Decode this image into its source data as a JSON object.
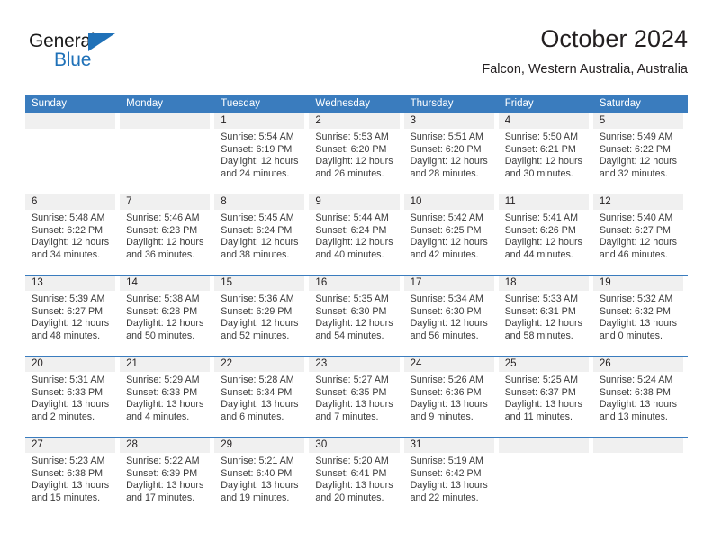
{
  "brand": {
    "name_top": "General",
    "name_bottom": "Blue",
    "triangle_icon": "blue-triangle-icon",
    "accent_color": "#1f71b8"
  },
  "header": {
    "title": "October 2024",
    "location": "Falcon, Western Australia, Australia"
  },
  "calendar": {
    "header_color": "#3a7cbe",
    "daynum_band_color": "#f0f0f0",
    "weekdays": [
      "Sunday",
      "Monday",
      "Tuesday",
      "Wednesday",
      "Thursday",
      "Friday",
      "Saturday"
    ],
    "weeks": [
      [
        {
          "day": "",
          "empty": true
        },
        {
          "day": "",
          "empty": true
        },
        {
          "day": "1",
          "sunrise": "Sunrise: 5:54 AM",
          "sunset": "Sunset: 6:19 PM",
          "daylight": "Daylight: 12 hours and 24 minutes."
        },
        {
          "day": "2",
          "sunrise": "Sunrise: 5:53 AM",
          "sunset": "Sunset: 6:20 PM",
          "daylight": "Daylight: 12 hours and 26 minutes."
        },
        {
          "day": "3",
          "sunrise": "Sunrise: 5:51 AM",
          "sunset": "Sunset: 6:20 PM",
          "daylight": "Daylight: 12 hours and 28 minutes."
        },
        {
          "day": "4",
          "sunrise": "Sunrise: 5:50 AM",
          "sunset": "Sunset: 6:21 PM",
          "daylight": "Daylight: 12 hours and 30 minutes."
        },
        {
          "day": "5",
          "sunrise": "Sunrise: 5:49 AM",
          "sunset": "Sunset: 6:22 PM",
          "daylight": "Daylight: 12 hours and 32 minutes."
        }
      ],
      [
        {
          "day": "6",
          "sunrise": "Sunrise: 5:48 AM",
          "sunset": "Sunset: 6:22 PM",
          "daylight": "Daylight: 12 hours and 34 minutes."
        },
        {
          "day": "7",
          "sunrise": "Sunrise: 5:46 AM",
          "sunset": "Sunset: 6:23 PM",
          "daylight": "Daylight: 12 hours and 36 minutes."
        },
        {
          "day": "8",
          "sunrise": "Sunrise: 5:45 AM",
          "sunset": "Sunset: 6:24 PM",
          "daylight": "Daylight: 12 hours and 38 minutes."
        },
        {
          "day": "9",
          "sunrise": "Sunrise: 5:44 AM",
          "sunset": "Sunset: 6:24 PM",
          "daylight": "Daylight: 12 hours and 40 minutes."
        },
        {
          "day": "10",
          "sunrise": "Sunrise: 5:42 AM",
          "sunset": "Sunset: 6:25 PM",
          "daylight": "Daylight: 12 hours and 42 minutes."
        },
        {
          "day": "11",
          "sunrise": "Sunrise: 5:41 AM",
          "sunset": "Sunset: 6:26 PM",
          "daylight": "Daylight: 12 hours and 44 minutes."
        },
        {
          "day": "12",
          "sunrise": "Sunrise: 5:40 AM",
          "sunset": "Sunset: 6:27 PM",
          "daylight": "Daylight: 12 hours and 46 minutes."
        }
      ],
      [
        {
          "day": "13",
          "sunrise": "Sunrise: 5:39 AM",
          "sunset": "Sunset: 6:27 PM",
          "daylight": "Daylight: 12 hours and 48 minutes."
        },
        {
          "day": "14",
          "sunrise": "Sunrise: 5:38 AM",
          "sunset": "Sunset: 6:28 PM",
          "daylight": "Daylight: 12 hours and 50 minutes."
        },
        {
          "day": "15",
          "sunrise": "Sunrise: 5:36 AM",
          "sunset": "Sunset: 6:29 PM",
          "daylight": "Daylight: 12 hours and 52 minutes."
        },
        {
          "day": "16",
          "sunrise": "Sunrise: 5:35 AM",
          "sunset": "Sunset: 6:30 PM",
          "daylight": "Daylight: 12 hours and 54 minutes."
        },
        {
          "day": "17",
          "sunrise": "Sunrise: 5:34 AM",
          "sunset": "Sunset: 6:30 PM",
          "daylight": "Daylight: 12 hours and 56 minutes."
        },
        {
          "day": "18",
          "sunrise": "Sunrise: 5:33 AM",
          "sunset": "Sunset: 6:31 PM",
          "daylight": "Daylight: 12 hours and 58 minutes."
        },
        {
          "day": "19",
          "sunrise": "Sunrise: 5:32 AM",
          "sunset": "Sunset: 6:32 PM",
          "daylight": "Daylight: 13 hours and 0 minutes."
        }
      ],
      [
        {
          "day": "20",
          "sunrise": "Sunrise: 5:31 AM",
          "sunset": "Sunset: 6:33 PM",
          "daylight": "Daylight: 13 hours and 2 minutes."
        },
        {
          "day": "21",
          "sunrise": "Sunrise: 5:29 AM",
          "sunset": "Sunset: 6:33 PM",
          "daylight": "Daylight: 13 hours and 4 minutes."
        },
        {
          "day": "22",
          "sunrise": "Sunrise: 5:28 AM",
          "sunset": "Sunset: 6:34 PM",
          "daylight": "Daylight: 13 hours and 6 minutes."
        },
        {
          "day": "23",
          "sunrise": "Sunrise: 5:27 AM",
          "sunset": "Sunset: 6:35 PM",
          "daylight": "Daylight: 13 hours and 7 minutes."
        },
        {
          "day": "24",
          "sunrise": "Sunrise: 5:26 AM",
          "sunset": "Sunset: 6:36 PM",
          "daylight": "Daylight: 13 hours and 9 minutes."
        },
        {
          "day": "25",
          "sunrise": "Sunrise: 5:25 AM",
          "sunset": "Sunset: 6:37 PM",
          "daylight": "Daylight: 13 hours and 11 minutes."
        },
        {
          "day": "26",
          "sunrise": "Sunrise: 5:24 AM",
          "sunset": "Sunset: 6:38 PM",
          "daylight": "Daylight: 13 hours and 13 minutes."
        }
      ],
      [
        {
          "day": "27",
          "sunrise": "Sunrise: 5:23 AM",
          "sunset": "Sunset: 6:38 PM",
          "daylight": "Daylight: 13 hours and 15 minutes."
        },
        {
          "day": "28",
          "sunrise": "Sunrise: 5:22 AM",
          "sunset": "Sunset: 6:39 PM",
          "daylight": "Daylight: 13 hours and 17 minutes."
        },
        {
          "day": "29",
          "sunrise": "Sunrise: 5:21 AM",
          "sunset": "Sunset: 6:40 PM",
          "daylight": "Daylight: 13 hours and 19 minutes."
        },
        {
          "day": "30",
          "sunrise": "Sunrise: 5:20 AM",
          "sunset": "Sunset: 6:41 PM",
          "daylight": "Daylight: 13 hours and 20 minutes."
        },
        {
          "day": "31",
          "sunrise": "Sunrise: 5:19 AM",
          "sunset": "Sunset: 6:42 PM",
          "daylight": "Daylight: 13 hours and 22 minutes."
        },
        {
          "day": "",
          "empty": true
        },
        {
          "day": "",
          "empty": true
        }
      ]
    ]
  }
}
